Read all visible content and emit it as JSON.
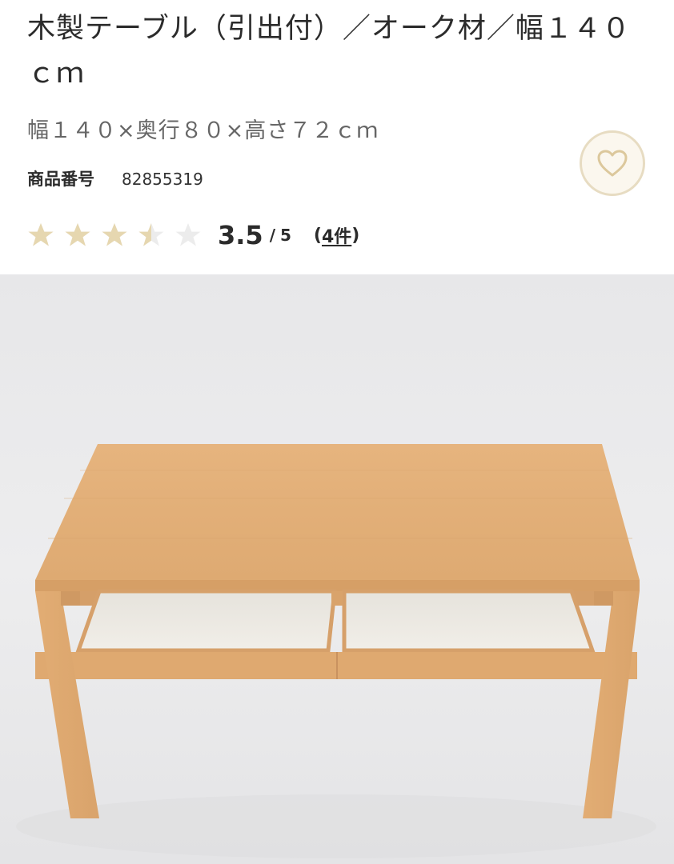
{
  "product": {
    "title": "木製テーブル（引出付）／オーク材／幅１４０ｃｍ",
    "size_spec": "幅１４０×奥行８０×高さ７２ｃｍ",
    "sku_label": "商品番号",
    "sku_value": "82855319"
  },
  "favorite": {
    "icon": "heart-icon"
  },
  "rating": {
    "value": 3.5,
    "score_text": "3.5",
    "slash": "/",
    "max_text": "5",
    "review_open": "(",
    "review_count_text": "4件",
    "review_close": ")",
    "star_filled_color": "#e6d7b0",
    "star_empty_color": "#ececec"
  },
  "image": {
    "description_icon": "product-photo",
    "wood_color": "#e3b07a",
    "drawer_interior_color": "#eeebe3"
  }
}
